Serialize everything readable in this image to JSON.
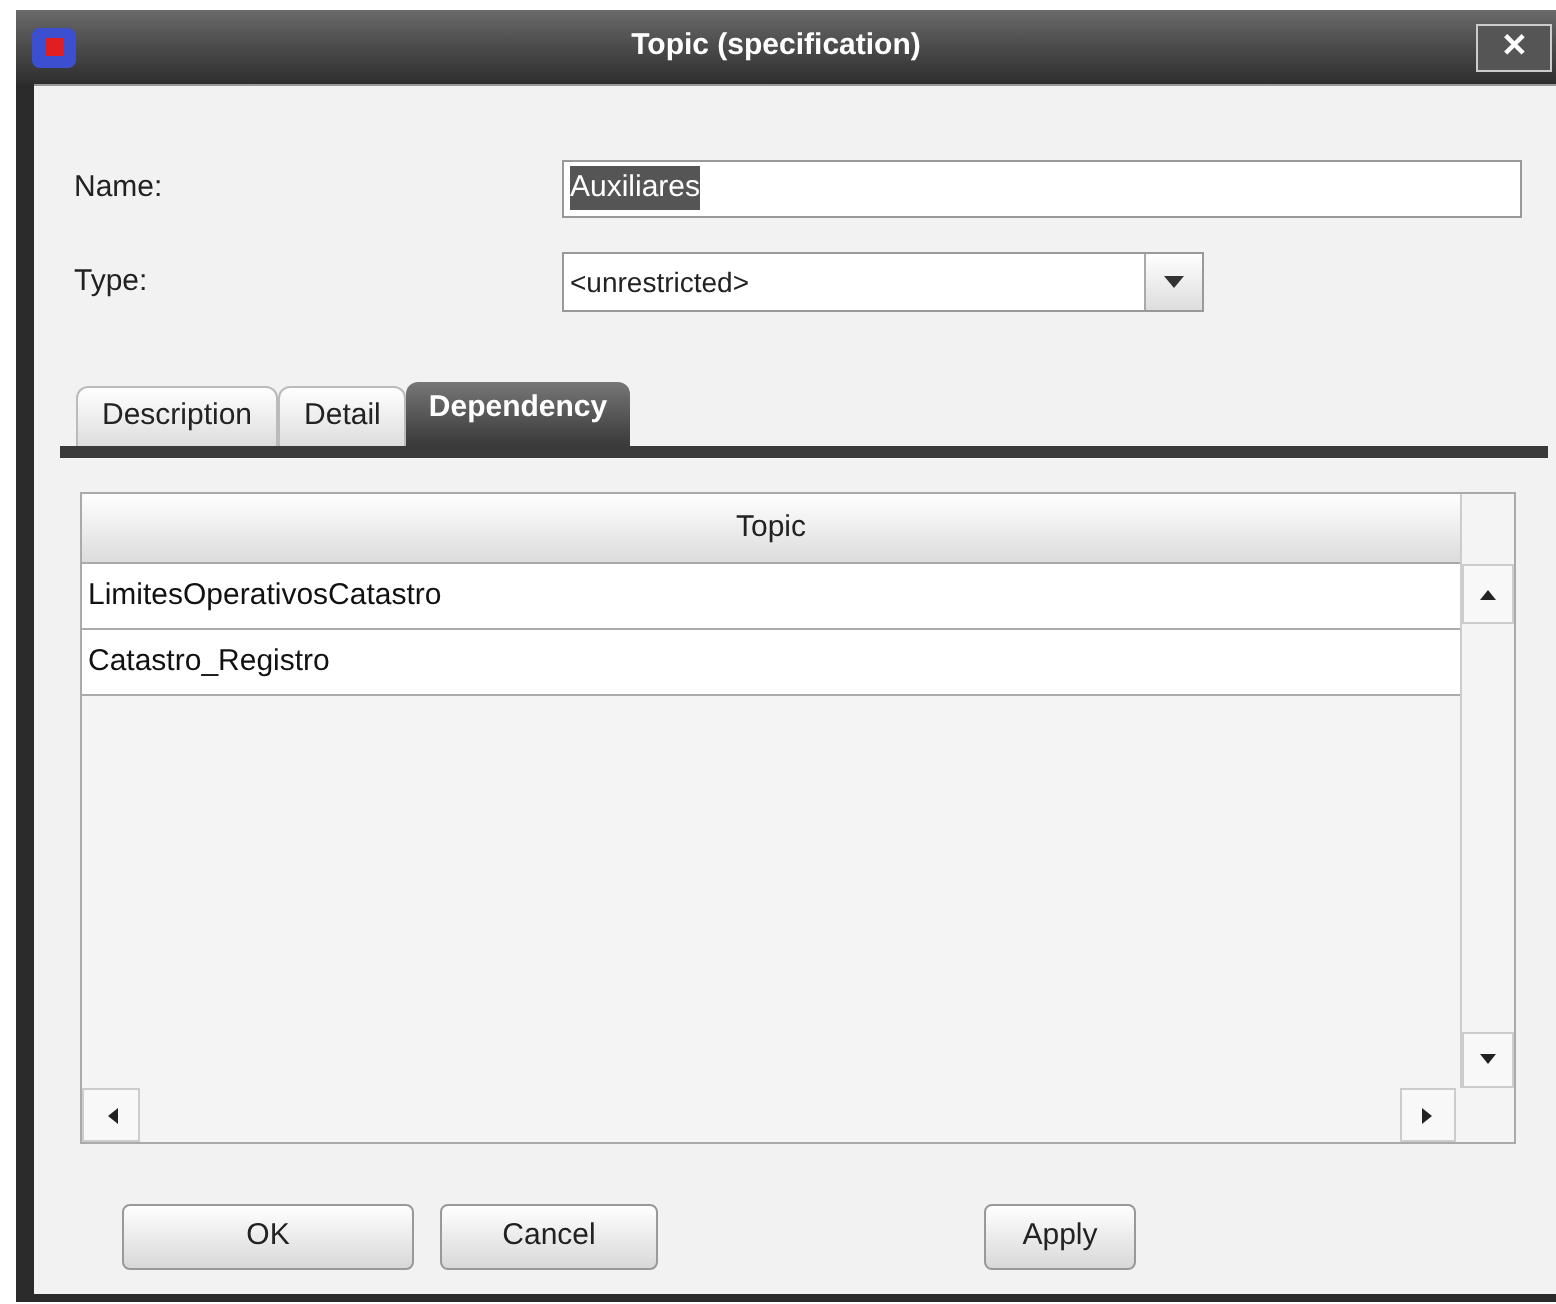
{
  "window": {
    "title": "Topic (specification)",
    "close": "✕"
  },
  "fields": [
    {
      "kind": "text",
      "label": "Name:",
      "value": "Auxiliares",
      "selected_text": true
    },
    {
      "kind": "dropdown",
      "label": "Type:",
      "value": "<unrestricted>"
    }
  ],
  "tabs": [
    {
      "label": "Description",
      "selected": false
    },
    {
      "label": "Detail",
      "selected": false
    },
    {
      "label": "Dependency",
      "selected": true
    }
  ],
  "table": {
    "columns": [
      "Topic"
    ],
    "rows": [
      [
        "LimitesOperativosCatastro"
      ],
      [
        "Catastro_Registro"
      ]
    ]
  },
  "buttons": [
    "OK",
    "Cancel",
    "Apply"
  ]
}
